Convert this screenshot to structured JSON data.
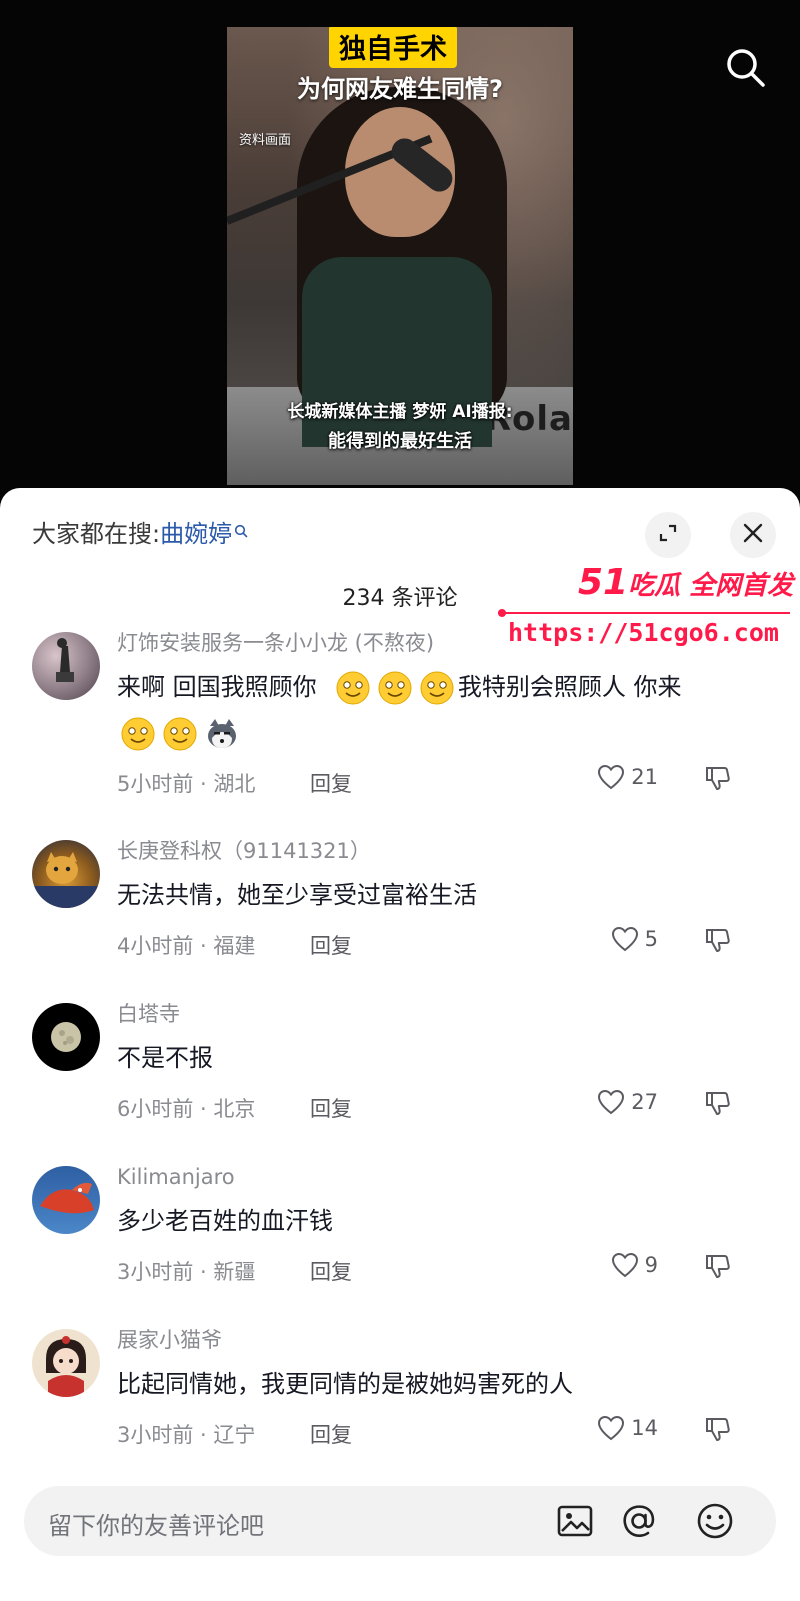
{
  "video": {
    "tag": "独自手术",
    "headline": "为何网友难生同情?",
    "source_label": "资料画面",
    "caption_line1": "长城新媒体主播 梦妍 AI播报:",
    "caption_line2": "能得到的最好生活",
    "keyboard_brand": "Rola"
  },
  "sheet": {
    "trending_prefix": "大家都在搜:",
    "trending_term": "曲婉婷",
    "comment_count": "234 条评论"
  },
  "watermark": {
    "brand_num": "51",
    "brand_text": "吃瓜 全网首发",
    "url": "https://51cgo6.com"
  },
  "comments": [
    {
      "name": "灯饰安装服务一条小小龙 (不熬夜)",
      "text_a": "来啊 回国我照顾你",
      "text_b": "我特别会照顾人 你来",
      "time_loc": "5小时前 · 湖北",
      "reply": "回复",
      "likes": "21"
    },
    {
      "name": "长庚登科权（91141321）",
      "text": "无法共情，她至少享受过富裕生活",
      "time_loc": "4小时前 · 福建",
      "reply": "回复",
      "likes": "5"
    },
    {
      "name": "白塔寺",
      "text": "不是不报",
      "time_loc": "6小时前 · 北京",
      "reply": "回复",
      "likes": "27"
    },
    {
      "name": "Kilimanjaro",
      "text": "多少老百姓的血汗钱",
      "time_loc": "3小时前 · 新疆",
      "reply": "回复",
      "likes": "9"
    },
    {
      "name": "展家小猫爷",
      "text": "比起同情她，我更同情的是被她妈害死的人",
      "time_loc": "3小时前 · 辽宁",
      "reply": "回复",
      "likes": "14"
    }
  ],
  "input": {
    "placeholder": "留下你的友善评论吧"
  }
}
